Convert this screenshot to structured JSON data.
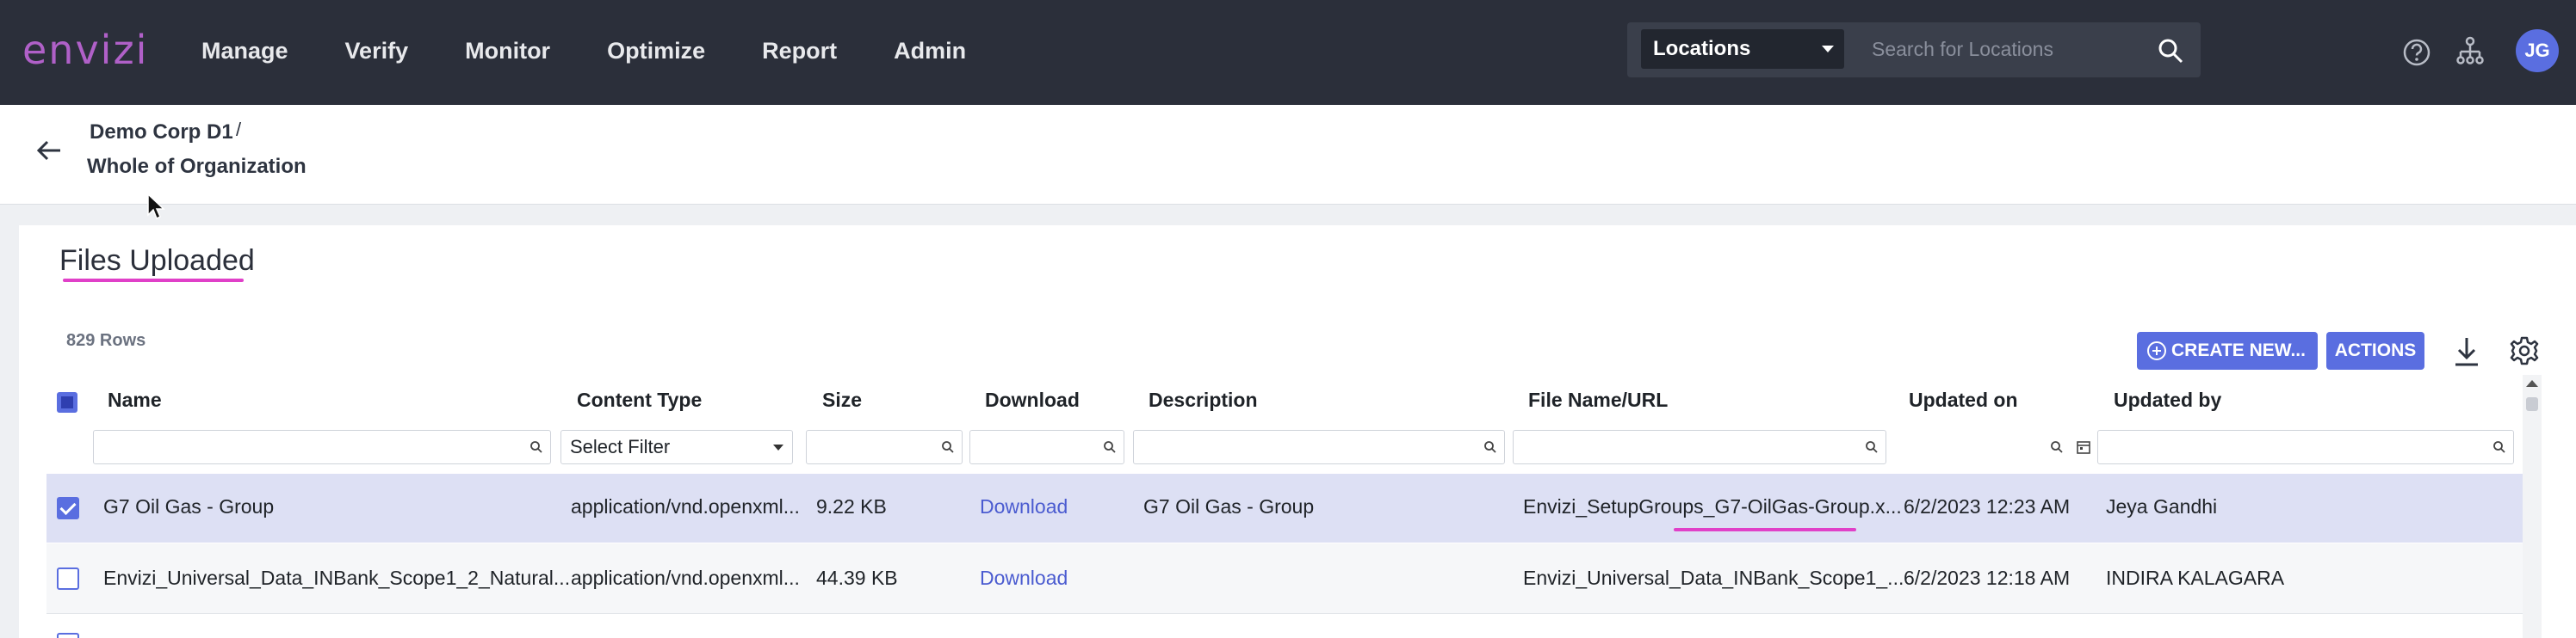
{
  "app": {
    "logo": "envizi"
  },
  "nav": {
    "items": [
      "Manage",
      "Verify",
      "Monitor",
      "Optimize",
      "Report",
      "Admin"
    ]
  },
  "search": {
    "scope": "Locations",
    "placeholder": "Search for Locations"
  },
  "user": {
    "initials": "JG"
  },
  "breadcrumb": {
    "parent": "Demo Corp D1",
    "separator": "/",
    "current": "Whole of Organization"
  },
  "panel": {
    "title": "Files Uploaded",
    "row_count": "829 Rows",
    "create_label": "CREATE NEW...",
    "actions_label": "ACTIONS"
  },
  "table": {
    "columns": [
      "Name",
      "Content Type",
      "Size",
      "Download",
      "Description",
      "File Name/URL",
      "Updated on",
      "Updated by"
    ],
    "content_type_filter": "Select Filter",
    "rows": [
      {
        "selected": true,
        "name": "G7 Oil Gas - Group",
        "content_type": "application/vnd.openxml...",
        "size": "9.22 KB",
        "download": "Download",
        "description": "G7 Oil Gas - Group",
        "file_name": "Envizi_SetupGroups_G7-OilGas-Group.x...",
        "updated_on": "6/2/2023 12:23 AM",
        "updated_by": "Jeya Gandhi"
      },
      {
        "selected": false,
        "name": "Envizi_Universal_Data_INBank_Scope1_2_Natural...",
        "content_type": "application/vnd.openxml...",
        "size": "44.39 KB",
        "download": "Download",
        "description": "",
        "file_name": "Envizi_Universal_Data_INBank_Scope1_...",
        "updated_on": "6/2/2023 12:18 AM",
        "updated_by": "INDIRA KALAGARA"
      }
    ]
  },
  "colors": {
    "topbar": "#2b2f3a",
    "accent": "#5a6ee0",
    "selected_row": "#dde0f4",
    "highlight": "#e040c8",
    "logo": "#b060c8"
  }
}
